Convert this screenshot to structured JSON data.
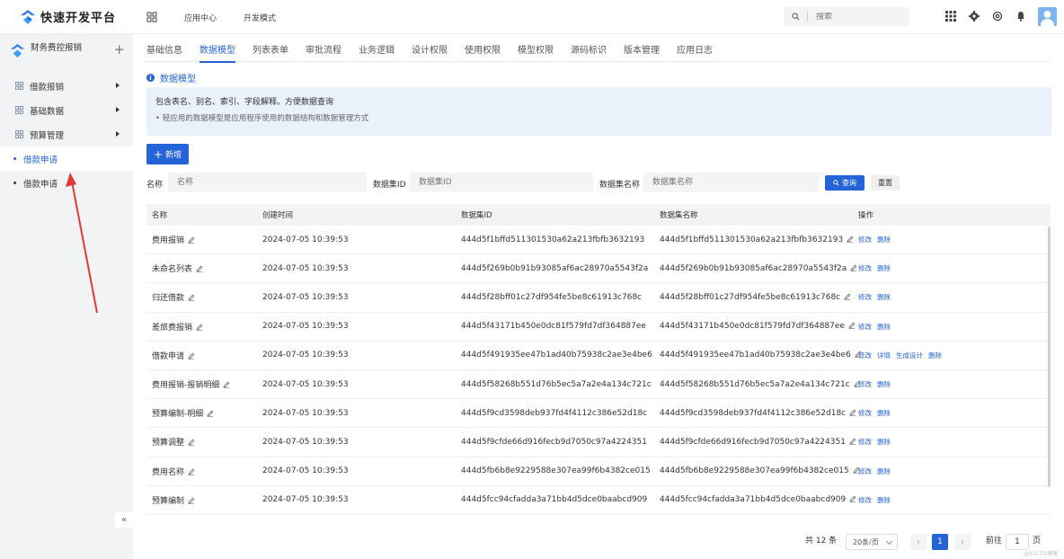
{
  "header": {
    "logo_text": "快速开发平台",
    "nav": [
      "应用中心",
      "开发模式"
    ],
    "search_placeholder": "搜索"
  },
  "sidebar": {
    "app_name": "财务费控报销",
    "add_symbol": "+",
    "groups": [
      {
        "label": "借款报销"
      },
      {
        "label": "基础数据"
      },
      {
        "label": "预算管理"
      }
    ],
    "leaves": [
      {
        "label": "借款申请",
        "active": true
      },
      {
        "label": "借款申请",
        "active": false
      }
    ],
    "collapse_symbol": "«"
  },
  "tabs": [
    "基础信息",
    "数据模型",
    "列表表单",
    "审批流程",
    "业务逻辑",
    "设计权限",
    "使用权限",
    "模型权限",
    "源码标识",
    "版本管理",
    "应用日志"
  ],
  "active_tab": "数据模型",
  "section": {
    "title": "数据模型",
    "info_line1": "包含表名、别名、索引、字段解释。方便数据查询",
    "info_line2": "• 轻应用的数据模型是应用程序使用的数据结构和数据管理方式"
  },
  "toolbar": {
    "add_label": "新增"
  },
  "filters": {
    "name_label": "名称",
    "name_placeholder": "名称",
    "dataset_id_label": "数据集ID",
    "dataset_id_placeholder": "数据集ID",
    "dataset_name_label": "数据集名称",
    "dataset_name_placeholder": "数据集名称",
    "query_label": "查询",
    "reset_label": "重置"
  },
  "table": {
    "columns": [
      "名称",
      "创建时间",
      "数据集ID",
      "数据集名称",
      "操作"
    ],
    "rows": [
      {
        "name": "费用报销",
        "created": "2024-07-05 10:39:53",
        "id": "444d5f1bffd511301530a62a213fbfb3632193",
        "dsname": "444d5f1bffd511301530a62a213fbfb3632193",
        "ops": [
          "修改",
          "删除"
        ]
      },
      {
        "name": "未命名列表",
        "created": "2024-07-05 10:39:53",
        "id": "444d5f269b0b91b93085af6ac28970a5543f2a",
        "dsname": "444d5f269b0b91b93085af6ac28970a5543f2a",
        "ops": [
          "修改",
          "删除"
        ]
      },
      {
        "name": "归还借款",
        "created": "2024-07-05 10:39:53",
        "id": "444d5f28bff01c27df954fe5be8c61913c768c",
        "dsname": "444d5f28bff01c27df954fe5be8c61913c768c",
        "ops": [
          "修改",
          "删除"
        ]
      },
      {
        "name": "差旅费报销",
        "created": "2024-07-05 10:39:53",
        "id": "444d5f43171b450e0dc81f579fd7df364887ee",
        "dsname": "444d5f43171b450e0dc81f579fd7df364887ee",
        "ops": [
          "修改",
          "删除"
        ]
      },
      {
        "name": "借款申请",
        "created": "2024-07-05 10:39:53",
        "id": "444d5f491935ee47b1ad40b75938c2ae3e4be6",
        "dsname": "444d5f491935ee47b1ad40b75938c2ae3e4be6",
        "ops": [
          "修改",
          "详情",
          "生成设计",
          "删除"
        ]
      },
      {
        "name": "费用报销-报销明细",
        "created": "2024-07-05 10:39:53",
        "id": "444d5f58268b551d76b5ec5a7a2e4a134c721c",
        "dsname": "444d5f58268b551d76b5ec5a7a2e4a134c721c",
        "ops": [
          "修改",
          "删除"
        ]
      },
      {
        "name": "预算编制-明细",
        "created": "2024-07-05 10:39:53",
        "id": "444d5f9cd3598deb937fd4f4112c386e52d18c",
        "dsname": "444d5f9cd3598deb937fd4f4112c386e52d18c",
        "ops": [
          "修改",
          "删除"
        ]
      },
      {
        "name": "预算调整",
        "created": "2024-07-05 10:39:53",
        "id": "444d5f9cfde66d916fecb9d7050c97a4224351",
        "dsname": "444d5f9cfde66d916fecb9d7050c97a4224351",
        "ops": [
          "修改",
          "删除"
        ]
      },
      {
        "name": "费用名称",
        "created": "2024-07-05 10:39:53",
        "id": "444d5fb6b8e9229588e307ea99f6b4382ce015",
        "dsname": "444d5fb6b8e9229588e307ea99f6b4382ce015",
        "ops": [
          "修改",
          "删除"
        ]
      },
      {
        "name": "预算编制",
        "created": "2024-07-05 10:39:53",
        "id": "444d5fcc94cfadda3a71bb4d5dce0baabcd909",
        "dsname": "444d5fcc94cfadda3a71bb4d5dce0baabcd909",
        "ops": [
          "修改",
          "删除"
        ]
      }
    ]
  },
  "pagination": {
    "total": "共 12 条",
    "page_size": "20条/页",
    "current_page": "1",
    "goto_label": "前往",
    "goto_value": "1",
    "page_unit": "页"
  },
  "watermark": "@51CTO博客",
  "colors": {
    "primary": "#2563d9",
    "sidebar_bg": "#f2f3f5",
    "info_bg": "#e9f1fb",
    "annotation_arrow": "#e53935"
  }
}
